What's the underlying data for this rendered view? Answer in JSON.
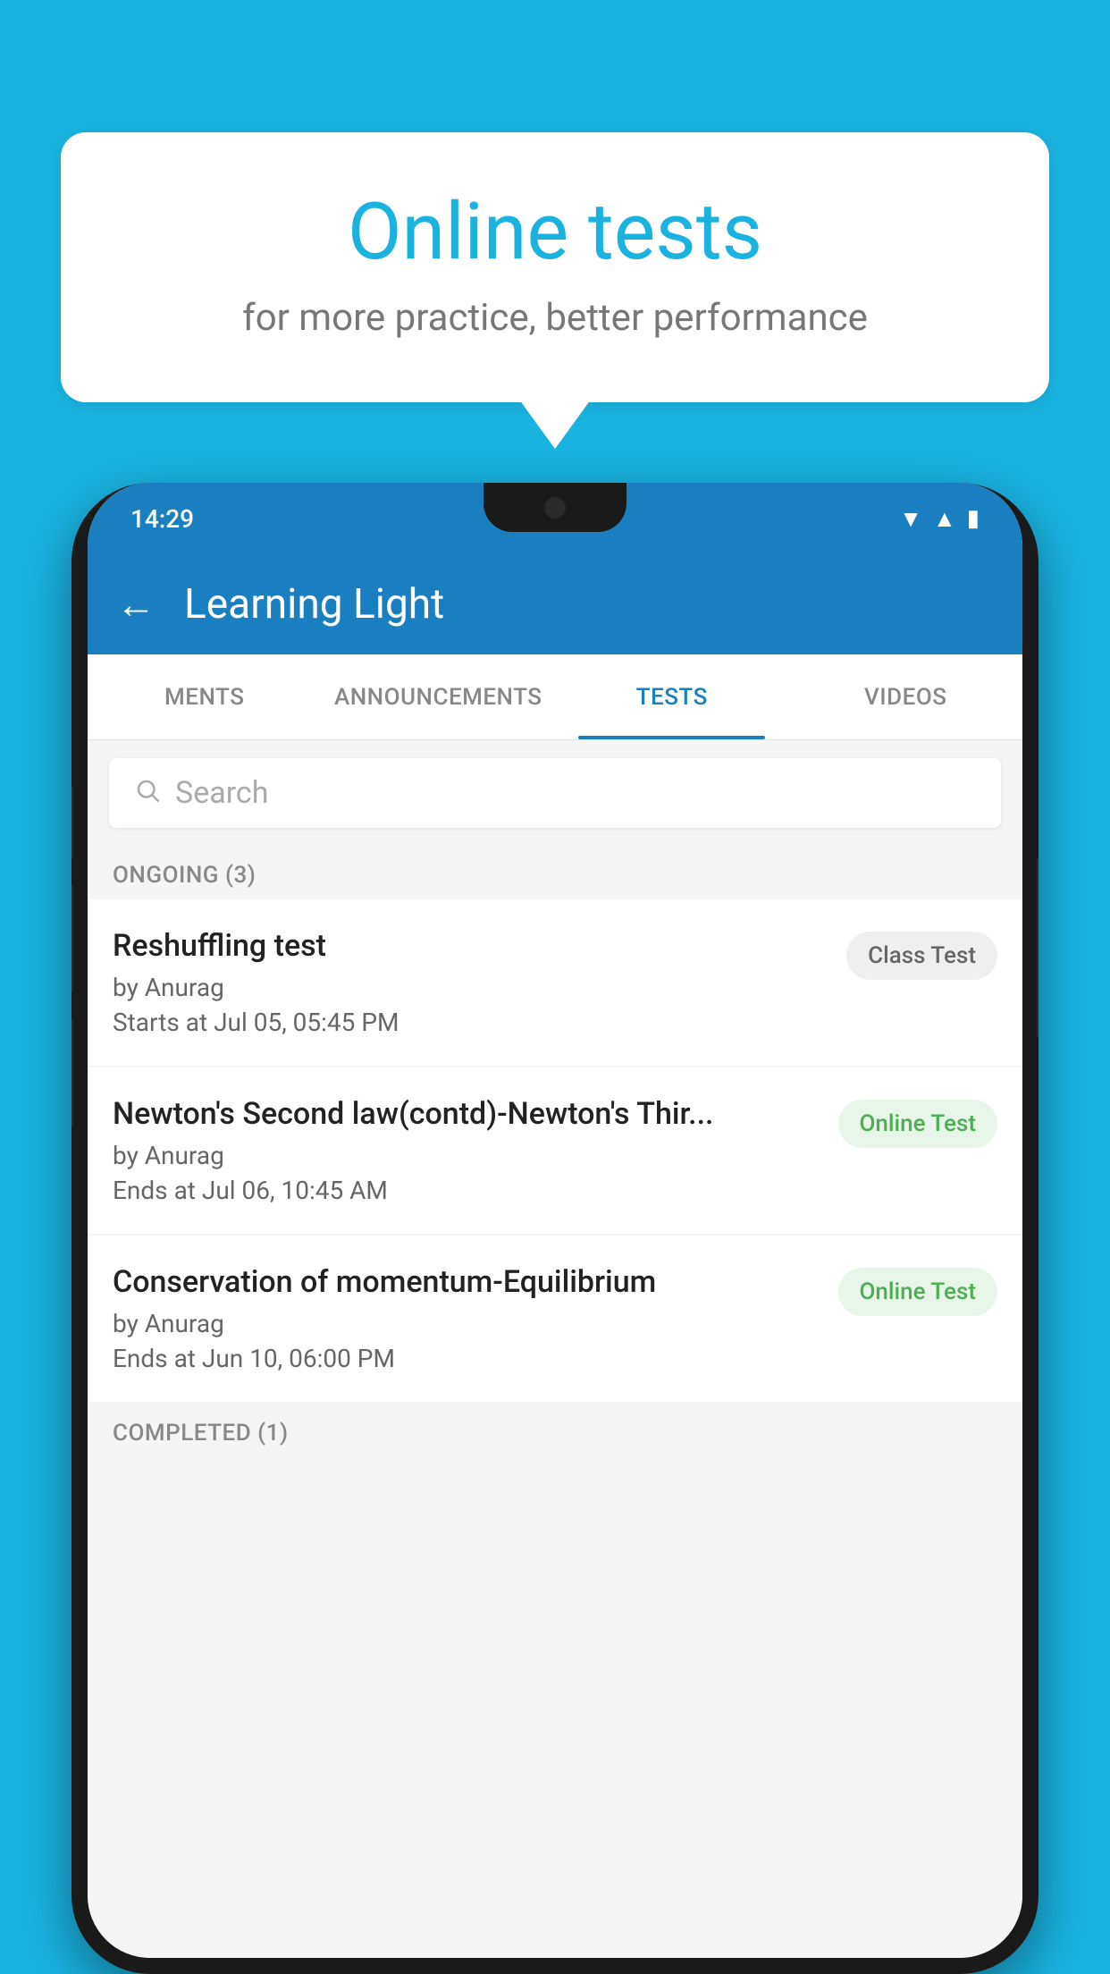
{
  "background": {
    "color": "#1ab3e0"
  },
  "bubble": {
    "title": "Online tests",
    "subtitle": "for more practice, better performance"
  },
  "phone": {
    "status_bar": {
      "time": "14:29"
    },
    "app_header": {
      "title": "Learning Light",
      "back_label": "←"
    },
    "tabs": [
      {
        "label": "MENTS",
        "active": false
      },
      {
        "label": "ANNOUNCEMENTS",
        "active": false
      },
      {
        "label": "TESTS",
        "active": true
      },
      {
        "label": "VIDEOS",
        "active": false
      }
    ],
    "search": {
      "placeholder": "Search"
    },
    "ongoing_section": {
      "label": "ONGOING (3)"
    },
    "tests": [
      {
        "name": "Reshuffling test",
        "author": "by Anurag",
        "time": "Starts at  Jul 05, 05:45 PM",
        "badge": "Class Test",
        "badge_type": "class"
      },
      {
        "name": "Newton's Second law(contd)-Newton's Thir...",
        "author": "by Anurag",
        "time": "Ends at  Jul 06, 10:45 AM",
        "badge": "Online Test",
        "badge_type": "online"
      },
      {
        "name": "Conservation of momentum-Equilibrium",
        "author": "by Anurag",
        "time": "Ends at  Jun 10, 06:00 PM",
        "badge": "Online Test",
        "badge_type": "online"
      }
    ],
    "completed_section": {
      "label": "COMPLETED (1)"
    }
  }
}
